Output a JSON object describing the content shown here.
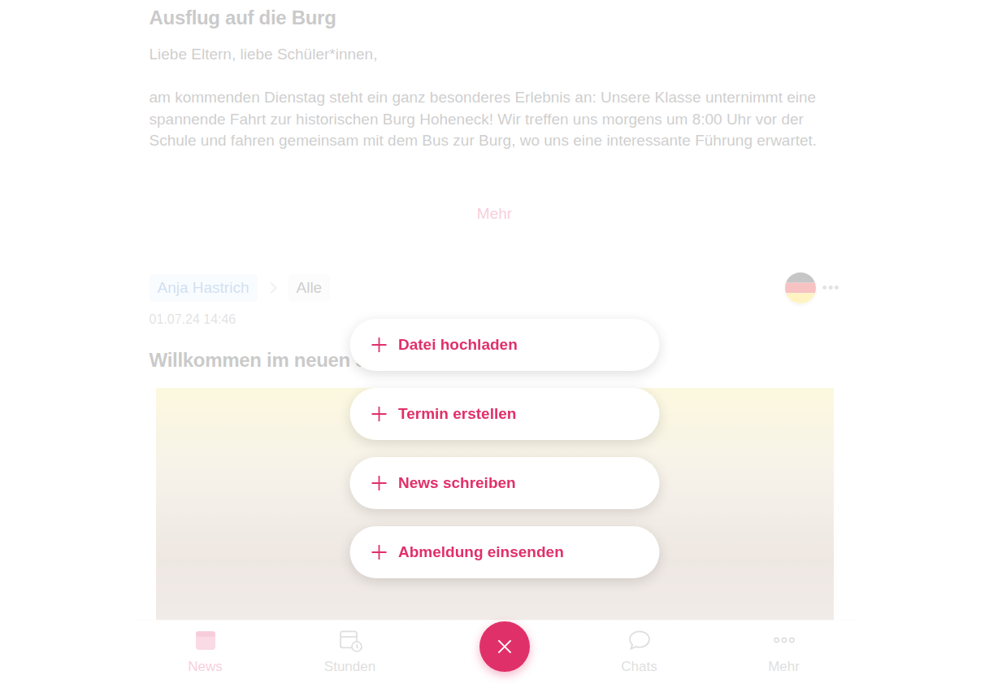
{
  "posts": [
    {
      "title": "Ausflug auf die Burg",
      "paragraphs": [
        "Liebe Eltern, liebe Schüler*innen,",
        "",
        "am kommenden Dienstag steht ein ganz besonderes Erlebnis an: Unsere Klasse unternimmt eine spannende Fahrt zur historischen Burg Hoheneck! Wir treffen uns morgens um 8:00 Uhr vor der Schule und fahren gemeinsam mit dem Bus zur Burg, wo uns eine interessante Führung erwartet."
      ],
      "more": "Mehr"
    },
    {
      "author": "Anja Hastrich",
      "audience": "Alle",
      "menu": "•••",
      "date": "01.07.24 14:46",
      "title": "Willkommen im neuen Schuljahr!"
    }
  ],
  "fab_menu": {
    "open": true,
    "items": [
      {
        "label": "Datei hochladen"
      },
      {
        "label": "Termin erstellen"
      },
      {
        "label": "News schreiben"
      },
      {
        "label": "Abmeldung einsenden"
      }
    ]
  },
  "nav": [
    {
      "label": "News",
      "selected": true
    },
    {
      "label": "Stunden",
      "selected": false
    },
    {
      "label": "Chats",
      "selected": false
    },
    {
      "label": "Mehr",
      "selected": false
    }
  ]
}
